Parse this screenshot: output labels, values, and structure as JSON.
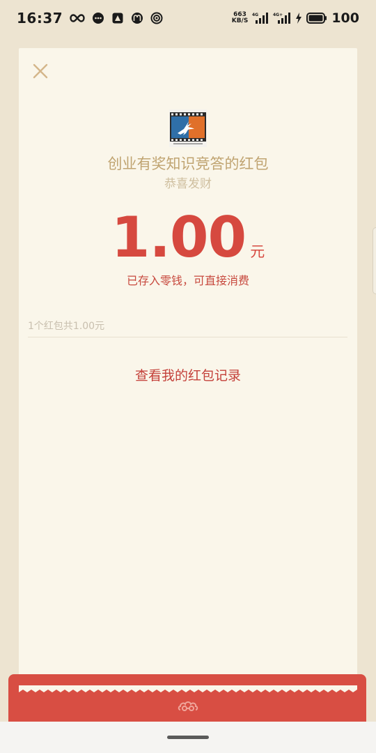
{
  "status_bar": {
    "time": "16:37",
    "net_speed_value": "663",
    "net_speed_unit": "KB/S",
    "sim1_label": "4G",
    "sim2_label": "4G+",
    "battery": "100"
  },
  "packet": {
    "title": "创业有奖知识竞答的红包",
    "greeting": "恭喜发财",
    "amount": "1.00",
    "unit": "元",
    "note": "已存入零钱，可直接消费",
    "summary": "1个红包共1.00元",
    "records_link": "查看我的红包记录"
  },
  "colors": {
    "background": "#ede4d1",
    "card": "#faf6ea",
    "accent_red": "#d6493f",
    "gold": "#c0a471"
  },
  "icons": {
    "close": "close-icon",
    "avatar": "antelope-film-logo",
    "bottom": "cloud-icon"
  }
}
